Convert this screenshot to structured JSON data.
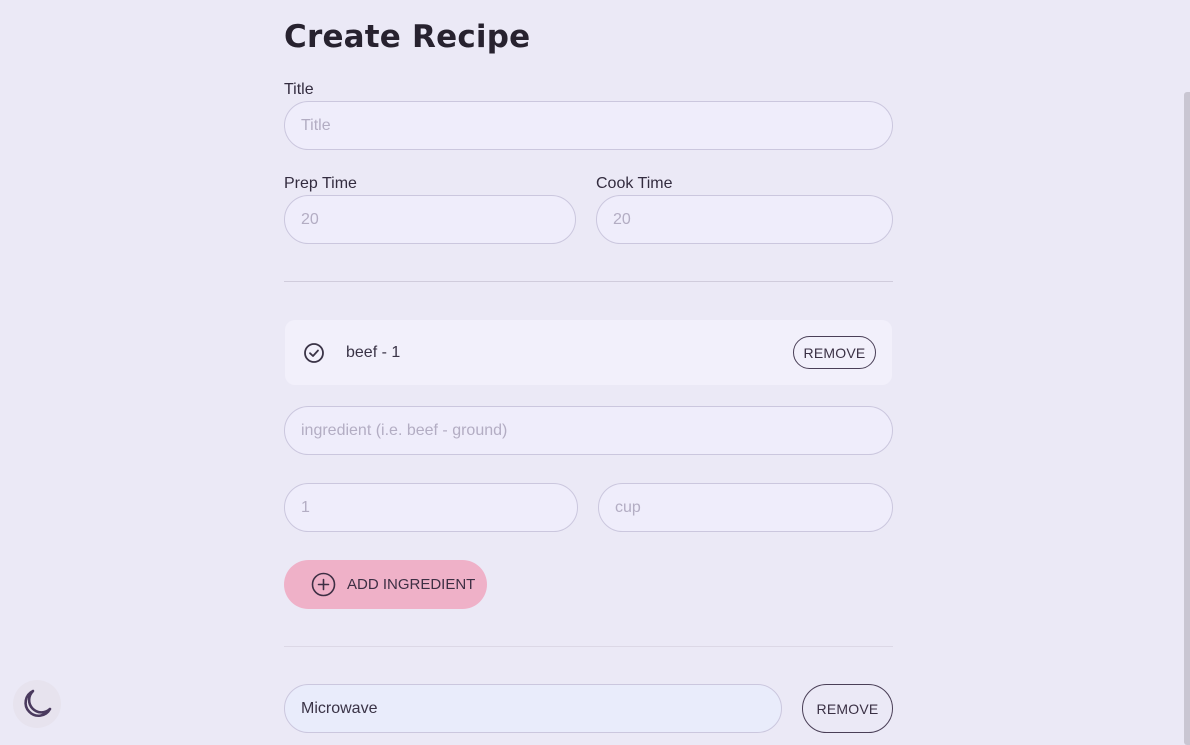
{
  "page": {
    "title": "Create Recipe"
  },
  "form": {
    "title_label": "Title",
    "title_placeholder": "Title",
    "prep_label": "Prep Time",
    "prep_placeholder": "20",
    "cook_label": "Cook Time",
    "cook_placeholder": "20"
  },
  "ingredients": {
    "items": [
      {
        "text": "beef - 1",
        "remove_label": "REMOVE"
      }
    ],
    "name_placeholder": "ingredient (i.e. beef - ground)",
    "quantity_placeholder": "1",
    "unit_placeholder": "cup",
    "add_button_label": "ADD INGREDIENT"
  },
  "equipment": {
    "items": [
      {
        "value": "Microwave",
        "remove_label": "REMOVE"
      }
    ]
  },
  "colors": {
    "background": "#ebe9f6",
    "accent": "#efb1c8",
    "text": "#2b2535"
  },
  "icons": {
    "ingredient_check": "check-circle-icon",
    "add": "plus-circle-icon",
    "theme": "moon-icon"
  }
}
